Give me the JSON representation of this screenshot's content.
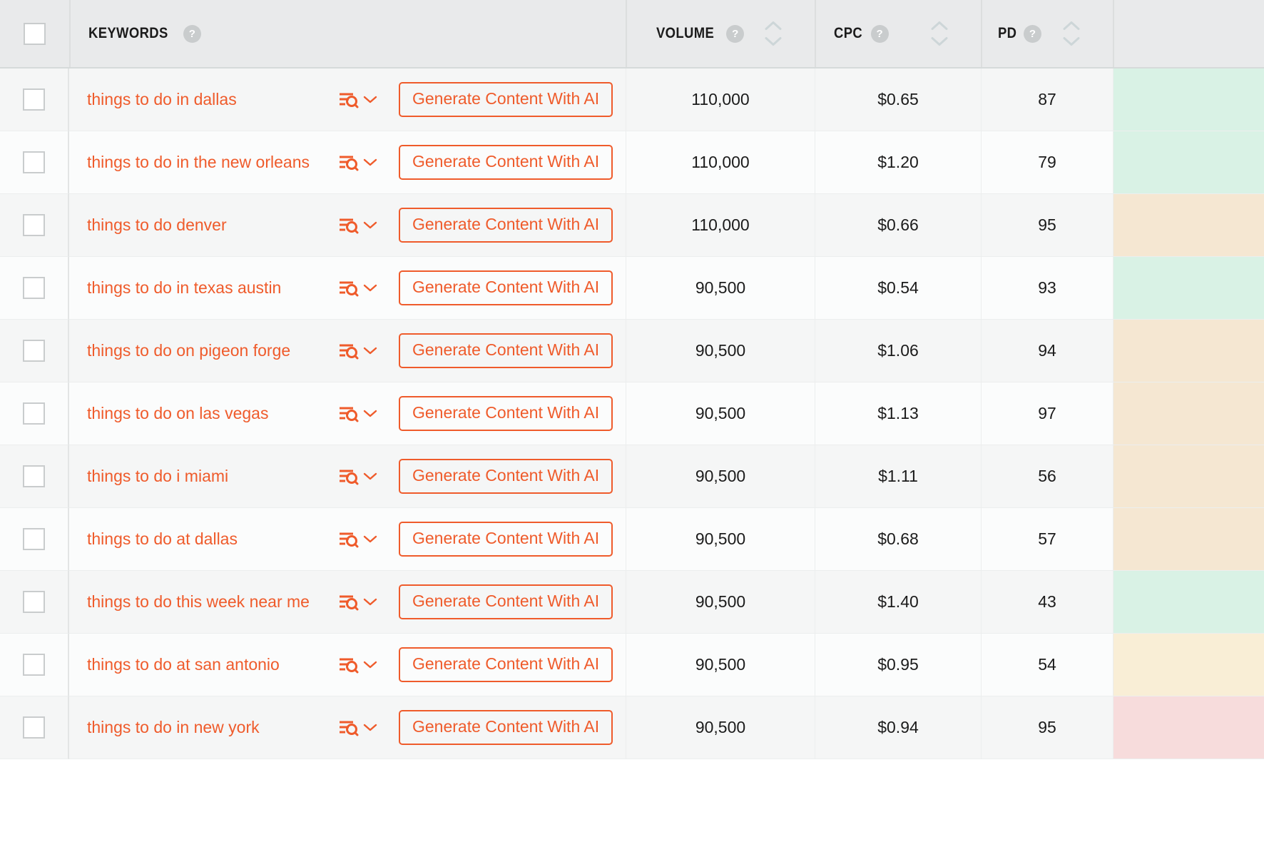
{
  "theme": {
    "accent": "#ef5b2b",
    "header_bg": "#e9eaeb",
    "row_odd_bg": "#f5f6f6",
    "row_even_bg": "#fbfcfc",
    "text": "#1b1b1b",
    "muted": "#c9cccd",
    "status_green": "#d9f2e5",
    "status_beige": "#f5e7d2",
    "status_pink": "#f7dcdc"
  },
  "table": {
    "columns": [
      {
        "key": "select",
        "label": "",
        "help": false,
        "sortable": false
      },
      {
        "key": "keyword",
        "label": "KEYWORDS",
        "help": true,
        "help_glyph": "?",
        "sortable": false
      },
      {
        "key": "volume",
        "label": "VOLUME",
        "help": true,
        "help_glyph": "?",
        "sortable": true
      },
      {
        "key": "cpc",
        "label": "CPC",
        "help": true,
        "help_glyph": "?",
        "sortable": true
      },
      {
        "key": "pd",
        "label": "PD",
        "help": true,
        "help_glyph": "?",
        "sortable": true
      }
    ],
    "select_all_checked": false,
    "action_button_label": "Generate Content With AI",
    "row_icon_name": "keyword-analysis-icon",
    "row_chevron_name": "chevron-down-icon",
    "sort_asc_icon": "chevron-up-icon",
    "sort_desc_icon": "chevron-down-icon",
    "rows": [
      {
        "keyword": "things to do in dallas",
        "volume": "110,000",
        "cpc": "$0.65",
        "pd": "87",
        "checked": false,
        "extra_color": "#d9f2e5"
      },
      {
        "keyword": "things to do in the new orleans",
        "volume": "110,000",
        "cpc": "$1.20",
        "pd": "79",
        "checked": false,
        "extra_color": "#d9f2e5"
      },
      {
        "keyword": "things to do denver",
        "volume": "110,000",
        "cpc": "$0.66",
        "pd": "95",
        "checked": false,
        "extra_color": "#f5e7d2"
      },
      {
        "keyword": "things to do in texas austin",
        "volume": "90,500",
        "cpc": "$0.54",
        "pd": "93",
        "checked": false,
        "extra_color": "#d9f2e5"
      },
      {
        "keyword": "things to do on pigeon forge",
        "volume": "90,500",
        "cpc": "$1.06",
        "pd": "94",
        "checked": false,
        "extra_color": "#f5e7d2"
      },
      {
        "keyword": "things to do on las vegas",
        "volume": "90,500",
        "cpc": "$1.13",
        "pd": "97",
        "checked": false,
        "extra_color": "#f5e7d2"
      },
      {
        "keyword": "things to do i miami",
        "volume": "90,500",
        "cpc": "$1.11",
        "pd": "56",
        "checked": false,
        "extra_color": "#f5e7d2"
      },
      {
        "keyword": "things to do at dallas",
        "volume": "90,500",
        "cpc": "$0.68",
        "pd": "57",
        "checked": false,
        "extra_color": "#f5e7d2"
      },
      {
        "keyword": "things to do this week near me",
        "volume": "90,500",
        "cpc": "$1.40",
        "pd": "43",
        "checked": false,
        "extra_color": "#d9f2e5"
      },
      {
        "keyword": "things to do at san antonio",
        "volume": "90,500",
        "cpc": "$0.95",
        "pd": "54",
        "checked": false,
        "extra_color": "#f9eed6"
      },
      {
        "keyword": "things to do in new york",
        "volume": "90,500",
        "cpc": "$0.94",
        "pd": "95",
        "checked": false,
        "extra_color": "#f7dcdc"
      }
    ]
  }
}
